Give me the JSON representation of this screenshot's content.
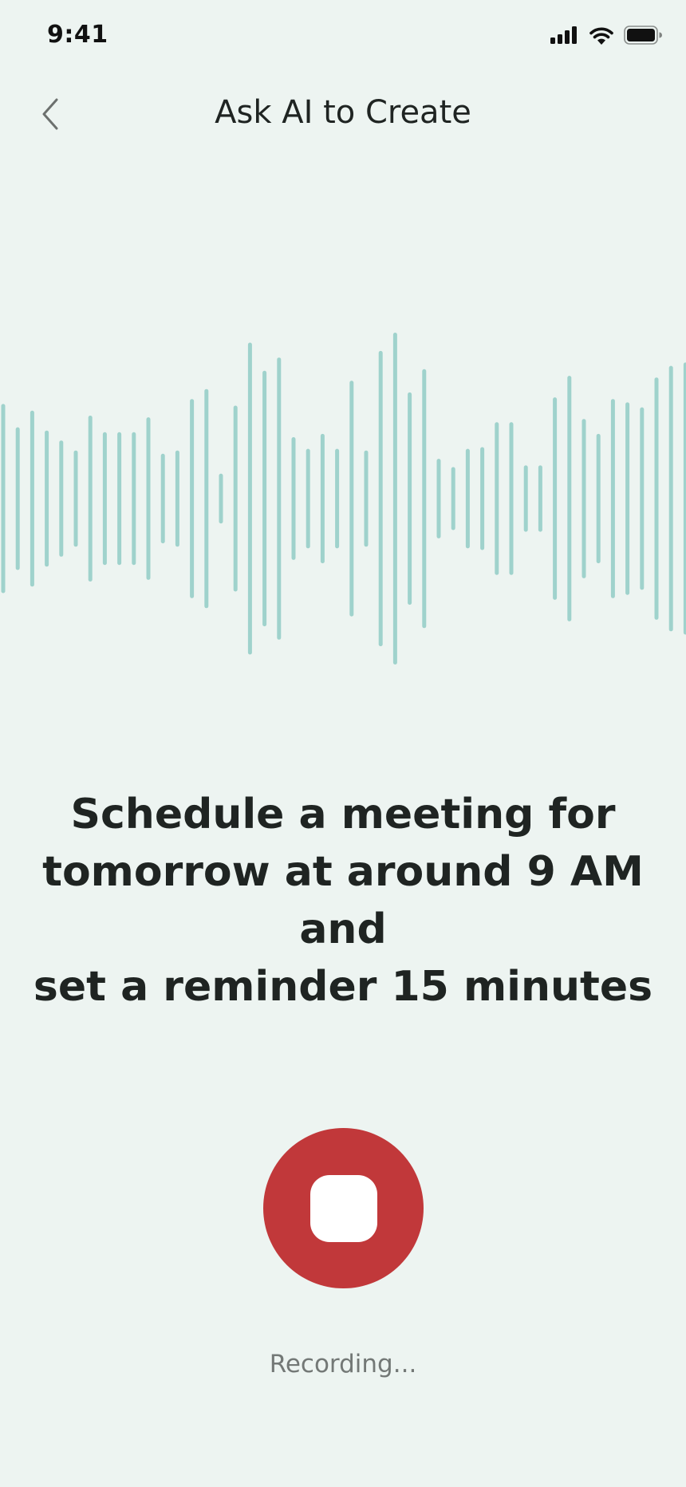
{
  "status_bar": {
    "time": "9:41",
    "icons": [
      "cellular-signal-icon",
      "wifi-icon",
      "battery-icon"
    ]
  },
  "header": {
    "back_icon": "chevron-left-icon",
    "title": "Ask AI to Create"
  },
  "transcript": {
    "lines": [
      "Schedule a meeting for",
      "tomorrow at around 9 AM and",
      "set a reminder 15 minutes"
    ]
  },
  "recorder": {
    "button_icon": "stop-icon",
    "status": "Recording...",
    "button_color": "#C1383A"
  },
  "colors": {
    "background": "#EDF4F1",
    "waveform": "#9FD2CC",
    "text": "#1F2422",
    "muted_text": "#737876"
  },
  "waveform": {
    "levels": [
      0.57,
      0.43,
      0.53,
      0.41,
      0.35,
      0.29,
      0.5,
      0.4,
      0.4,
      0.4,
      0.49,
      0.27,
      0.29,
      0.6,
      0.66,
      0.15,
      0.56,
      0.94,
      0.77,
      0.85,
      0.37,
      0.3,
      0.39,
      0.3,
      0.71,
      0.29,
      0.89,
      1.0,
      0.64,
      0.78,
      0.24,
      0.19,
      0.3,
      0.31,
      0.46,
      0.46,
      0.2,
      0.2,
      0.61,
      0.74,
      0.48,
      0.39,
      0.6,
      0.58,
      0.55,
      0.73,
      0.8,
      0.82,
      0.79,
      0.46,
      0.6
    ]
  }
}
